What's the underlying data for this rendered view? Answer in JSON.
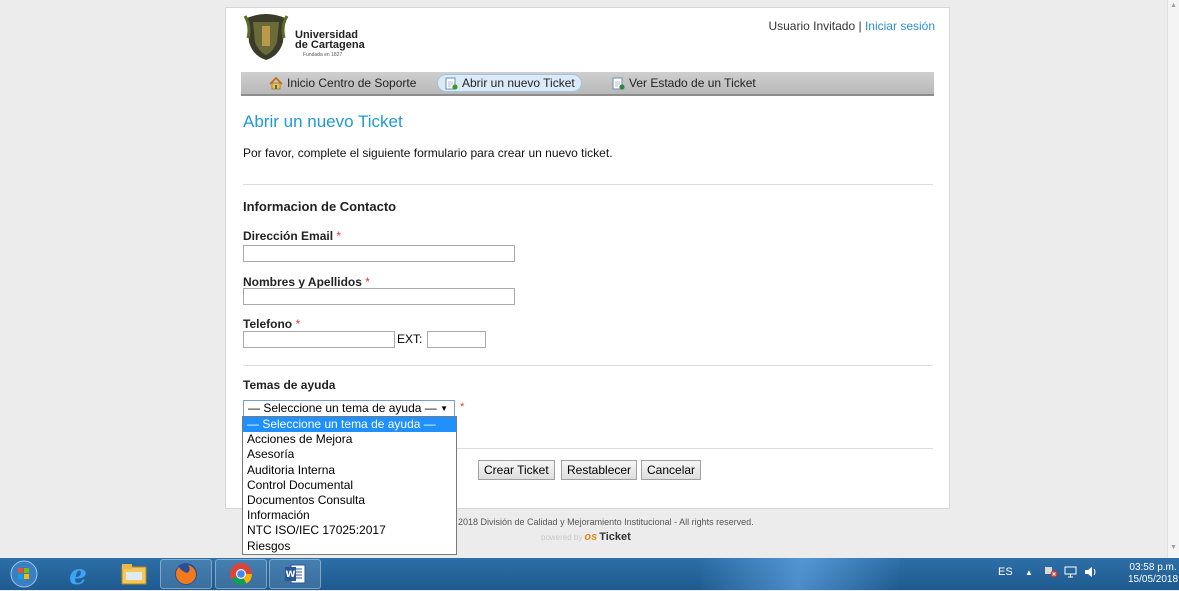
{
  "header": {
    "logo_line1": "Universidad",
    "logo_line2": "de Cartagena",
    "logo_line3": "Fundada en 1827",
    "user_label": "Usuario Invitado",
    "separator": "|",
    "login_link": "Iniciar sesión"
  },
  "nav": {
    "home": "Inicio Centro de Soporte",
    "open_ticket": "Abrir un nuevo Ticket",
    "ticket_status": "Ver Estado de un Ticket"
  },
  "main": {
    "title": "Abrir un nuevo Ticket",
    "intro": "Por favor, complete el siguiente formulario para crear un nuevo ticket.",
    "contact_section": "Informacion de Contacto",
    "email_label": "Dirección Email",
    "email_value": "",
    "name_label": "Nombres y Apellidos",
    "name_value": "",
    "phone_label": "Telefono",
    "phone_value": "",
    "ext_label": "EXT:",
    "ext_value": "",
    "required_mark": "*",
    "topics_section": "Temas de ayuda",
    "topic_selected": "— Seleccione un tema de ayuda —",
    "topic_options": [
      "— Seleccione un tema de ayuda —",
      "Acciones de Mejora",
      "Asesoría",
      "Auditoria Interna",
      "Control Documental",
      "Documentos Consulta",
      "Información",
      "NTC ISO/IEC 17025:2017",
      "Riesgos"
    ],
    "buttons": {
      "create": "Crear Ticket",
      "reset": "Restablecer",
      "cancel": "Cancelar"
    }
  },
  "footer": {
    "copyright": "2018 División de Calidad y Mejoramiento Institucional - All rights reserved.",
    "powered_by": "powered by",
    "os_brand": "os",
    "ticket_brand": "Ticket"
  },
  "taskbar": {
    "language": "ES",
    "time": "03:58 p.m.",
    "date": "15/05/2018"
  },
  "colors": {
    "accent": "#1f9ad6",
    "required": "#e23b3b",
    "taskbar": "#245f96",
    "selected_option": "#1e90ff"
  }
}
